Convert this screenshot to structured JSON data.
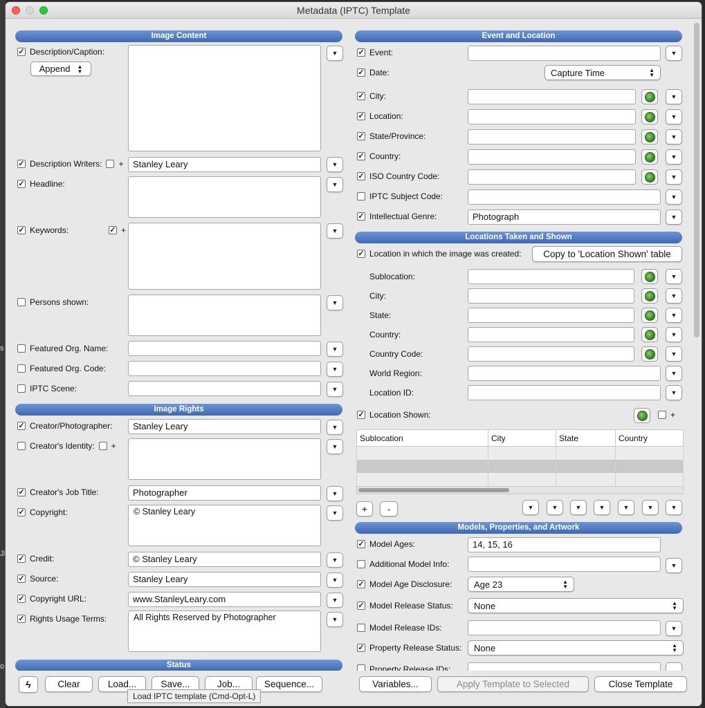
{
  "window": {
    "title": "Metadata (IPTC) Template"
  },
  "left_edge": {
    "chars": [
      "s",
      "JI",
      "o"
    ]
  },
  "image_content": {
    "header": "Image Content",
    "description": {
      "label": "Description/Caption:",
      "mode": "Append",
      "value": ""
    },
    "description_writers": {
      "label": "Description Writers:",
      "plus": "+",
      "value": "Stanley Leary"
    },
    "headline": {
      "label": "Headline:",
      "value": ""
    },
    "keywords": {
      "label": "Keywords:",
      "plus": "+",
      "value": ""
    },
    "persons_shown": {
      "label": "Persons shown:",
      "value": ""
    },
    "featured_org_name": {
      "label": "Featured Org. Name:",
      "value": ""
    },
    "featured_org_code": {
      "label": "Featured Org. Code:",
      "value": ""
    },
    "iptc_scene": {
      "label": "IPTC Scene:",
      "value": ""
    }
  },
  "image_rights": {
    "header": "Image Rights",
    "creator": {
      "label": "Creator/Photographer:",
      "value": "Stanley Leary"
    },
    "creator_identity": {
      "label": "Creator's Identity:",
      "plus": "+",
      "value": ""
    },
    "job_title": {
      "label": "Creator's Job Title:",
      "value": "Photographer"
    },
    "copyright": {
      "label": "Copyright:",
      "value": "© Stanley Leary"
    },
    "credit": {
      "label": "Credit:",
      "value": "© Stanley Leary"
    },
    "source": {
      "label": "Source:",
      "value": "Stanley Leary"
    },
    "copyright_url": {
      "label": "Copyright URL:",
      "value": "www.StanleyLeary.com"
    },
    "rights_usage": {
      "label": "Rights Usage Terms:",
      "value": "All Rights Reserved by Photographer"
    }
  },
  "status": {
    "header": "Status"
  },
  "event_location": {
    "header": "Event and Location",
    "event": {
      "label": "Event:",
      "value": ""
    },
    "date": {
      "label": "Date:",
      "value": "Capture Time"
    },
    "city": {
      "label": "City:",
      "value": ""
    },
    "location": {
      "label": "Location:",
      "value": ""
    },
    "state": {
      "label": "State/Province:",
      "value": ""
    },
    "country": {
      "label": "Country:",
      "value": ""
    },
    "iso_code": {
      "label": "ISO Country Code:",
      "value": ""
    },
    "subject_code": {
      "label": "IPTC Subject Code:",
      "value": ""
    },
    "genre": {
      "label": "Intellectual Genre:",
      "value": "Photograph"
    }
  },
  "locations_taken": {
    "header": "Locations Taken and Shown",
    "created_label": "Location in which the image was created:",
    "copy_button": "Copy to 'Location Shown' table",
    "sublocation": "Sublocation:",
    "city": "City:",
    "state": "State:",
    "country": "Country:",
    "country_code": "Country Code:",
    "world_region": "World Region:",
    "location_id": "Location ID:",
    "shown_label": "Location Shown:",
    "shown_plus": "+",
    "columns": [
      "Sublocation",
      "City",
      "State",
      "Country"
    ],
    "add": "+",
    "remove": "-"
  },
  "models": {
    "header": "Models, Properties, and Artwork",
    "ages": {
      "label": "Model Ages:",
      "value": "14, 15, 16"
    },
    "additional_info": {
      "label": "Additional Model Info:",
      "value": ""
    },
    "age_disclosure": {
      "label": "Model Age Disclosure:",
      "value": "Age 23"
    },
    "release_status": {
      "label": "Model Release Status:",
      "value": "None"
    },
    "release_ids": {
      "label": "Model Release IDs:",
      "value": ""
    },
    "property_status": {
      "label": "Property Release Status:",
      "value": "None"
    },
    "property_ids": {
      "label": "Property Release IDs:",
      "value": ""
    }
  },
  "footer": {
    "clear": "Clear",
    "load": "Load...",
    "save": "Save...",
    "job": "Job...",
    "sequence": "Sequence...",
    "variables": "Variables...",
    "apply": "Apply Template to Selected",
    "close": "Close Template",
    "tooltip": "Load IPTC template (Cmd-Opt-L)"
  },
  "colors": {
    "section_header": "#4a73bb",
    "window_bg": "#e8e8e8",
    "globe": "#3a8a2a"
  }
}
